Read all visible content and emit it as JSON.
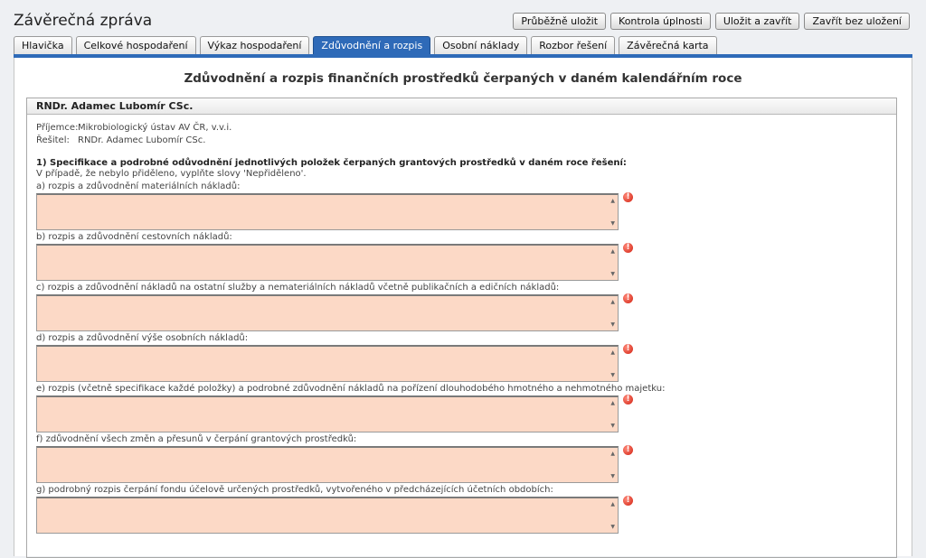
{
  "page": {
    "title": "Závěrečná zpráva",
    "buttons": [
      "Průběžně uložit",
      "Kontrola úplnosti",
      "Uložit a zavřít",
      "Zavřít bez uložení"
    ]
  },
  "tabs": [
    {
      "label": "Hlavička",
      "active": false
    },
    {
      "label": "Celkové hospodaření",
      "active": false
    },
    {
      "label": "Výkaz hospodaření",
      "active": false
    },
    {
      "label": "Zdůvodnění a rozpis",
      "active": true
    },
    {
      "label": "Osobní náklady",
      "active": false
    },
    {
      "label": "Rozbor řešení",
      "active": false
    },
    {
      "label": "Závěrečná karta",
      "active": false
    }
  ],
  "main": {
    "heading": "Zdůvodnění a rozpis finančních prostředků čerpaných v daném kalendářním roce",
    "box_title": "RNDr. Adamec Lubomír CSc.",
    "recipient_label": "Příjemce:",
    "recipient_value": "Mikrobiologický ústav AV ČR, v.v.i.",
    "solver_label": "Řešitel:",
    "solver_value": "RNDr. Adamec Lubomír CSc.",
    "section_title": "1) Specifikace a podrobné odůvodnění jednotlivých položek čerpaných grantových prostředků v daném roce řešení:",
    "section_note": "V případě, že nebylo přiděleno, vyplňte slovy 'Nepřiděleno'.",
    "fields": [
      {
        "label": "a) rozpis a zdůvodnění materiálních nákladů:",
        "value": ""
      },
      {
        "label": "b) rozpis a zdůvodnění cestovních nákladů:",
        "value": ""
      },
      {
        "label": "c) rozpis a zdůvodnění nákladů na ostatní služby a nemateriálních nákladů včetně publikačních a edičních nákladů:",
        "value": ""
      },
      {
        "label": "d) rozpis a zdůvodnění výše osobních nákladů:",
        "value": ""
      },
      {
        "label": "e) rozpis (včetně specifikace každé položky) a podrobné zdůvodnění nákladů na pořízení dlouhodobého hmotného a nehmotného majetku:",
        "value": ""
      },
      {
        "label": "f) zdůvodnění všech změn a přesunů v čerpání grantových prostředků:",
        "value": ""
      },
      {
        "label": "g) podrobný rozpis čerpání fondu účelově určených prostředků, vytvořeného v předcházejících účetních obdobích:",
        "value": ""
      }
    ],
    "error_icon": "!",
    "field_color": "#fcd9c6",
    "accent_color": "#2e6ab8"
  }
}
